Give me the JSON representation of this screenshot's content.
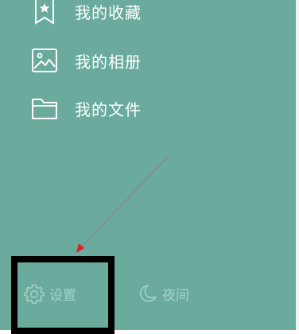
{
  "menu": {
    "items": [
      {
        "label": "我的收藏",
        "icon": "bookmark-star-icon"
      },
      {
        "label": "我的相册",
        "icon": "image-icon"
      },
      {
        "label": "我的文件",
        "icon": "folder-icon"
      }
    ]
  },
  "footer": {
    "settings_label": "设置",
    "settings_icon": "gear-icon",
    "night_label": "夜间",
    "night_icon": "moon-icon"
  },
  "colors": {
    "panel_background": "#6aab9e",
    "menu_text": "#ffffff",
    "footer_text": "#a6d2c9",
    "annotation_box": "#000000",
    "annotation_arrow": "#e02020"
  }
}
